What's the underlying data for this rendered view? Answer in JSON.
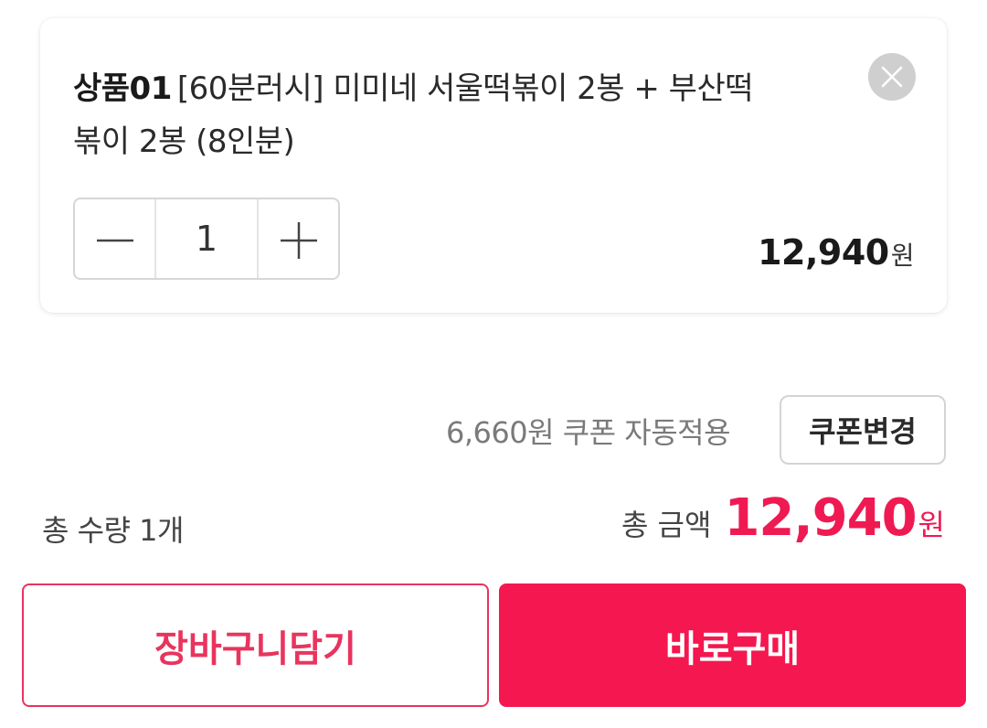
{
  "product": {
    "code": "상품01",
    "name": "[60분러시] 미미네 서울떡볶이 2봉 + 부산떡볶이 2봉 (8인분)",
    "quantity": "1",
    "price": "12,940",
    "price_unit": "원",
    "remove_icon": "close-icon",
    "decrease_icon": "minus-icon",
    "increase_icon": "plus-icon"
  },
  "coupon": {
    "text": "6,660원 쿠폰 자동적용",
    "button_label": "쿠폰변경"
  },
  "summary": {
    "total_quantity_text": "총 수량 1개",
    "total_amount_label": "총 금액",
    "total_amount_value": "12,940",
    "total_amount_unit": "원"
  },
  "actions": {
    "cart_label": "장바구니담기",
    "buy_label": "바로구매"
  },
  "colors": {
    "accent": "#ef1a52",
    "buy_button": "#f5174f",
    "cart_border": "#e8345e"
  }
}
